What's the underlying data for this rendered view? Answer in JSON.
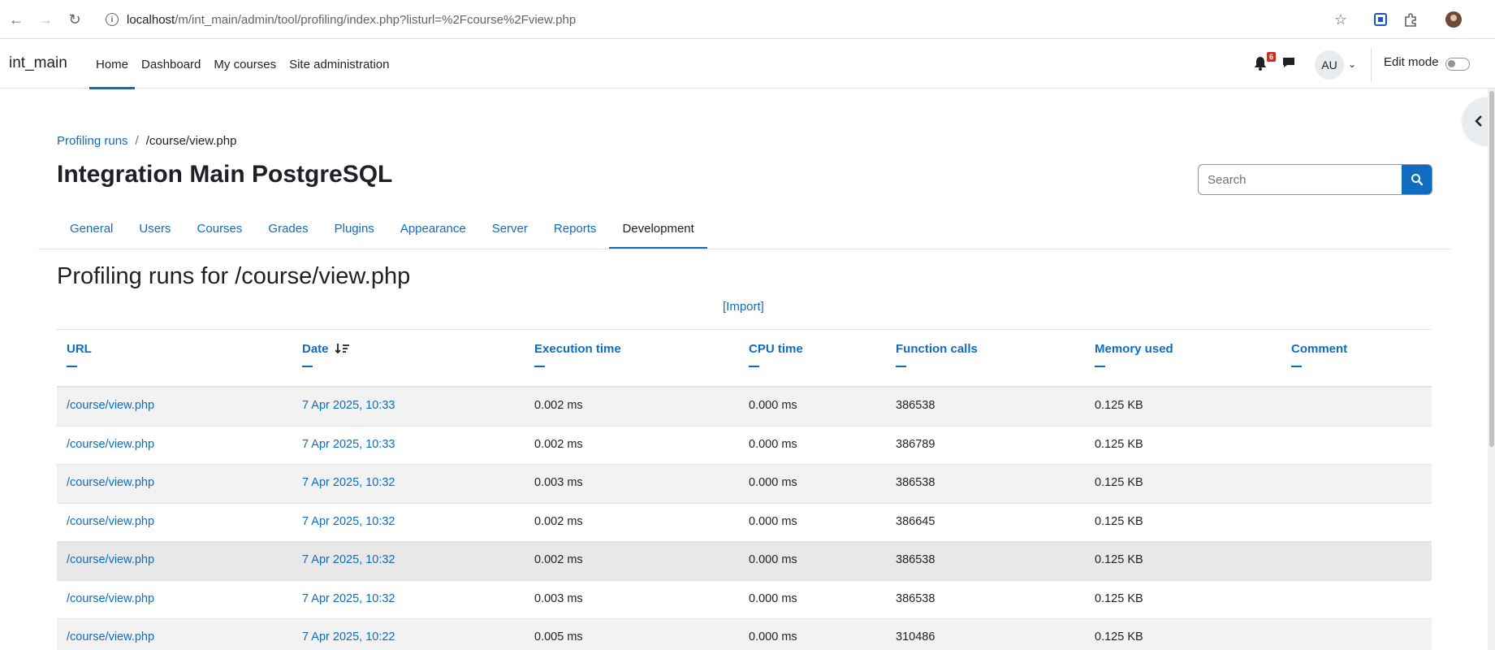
{
  "browser": {
    "url_host": "localhost",
    "url_path": "/m/int_main/admin/tool/profiling/index.php?listurl=%2Fcourse%2Fview.php"
  },
  "navbar": {
    "site_name": "int_main",
    "items": [
      {
        "label": "Home",
        "active": true
      },
      {
        "label": "Dashboard",
        "active": false
      },
      {
        "label": "My courses",
        "active": false
      },
      {
        "label": "Site administration",
        "active": false
      }
    ],
    "notification_count": "6",
    "avatar_initials": "AU",
    "edit_mode_label": "Edit mode",
    "edit_mode_on": false
  },
  "breadcrumb": {
    "link": "Profiling runs",
    "separator": "/",
    "current": "/course/view.php"
  },
  "page_title": "Integration Main PostgreSQL",
  "search": {
    "placeholder": "Search"
  },
  "tabs": [
    {
      "label": "General",
      "active": false
    },
    {
      "label": "Users",
      "active": false
    },
    {
      "label": "Courses",
      "active": false
    },
    {
      "label": "Grades",
      "active": false
    },
    {
      "label": "Plugins",
      "active": false
    },
    {
      "label": "Appearance",
      "active": false
    },
    {
      "label": "Server",
      "active": false
    },
    {
      "label": "Reports",
      "active": false
    },
    {
      "label": "Development",
      "active": true
    }
  ],
  "runs_title": "Profiling runs for /course/view.php",
  "import_label": "[Import]",
  "table": {
    "columns": [
      "URL",
      "Date",
      "Execution time",
      "CPU time",
      "Function calls",
      "Memory used",
      "Comment"
    ],
    "rows": [
      [
        "/course/view.php",
        "7 Apr 2025, 10:33",
        "0.002 ms",
        "0.000 ms",
        "386538",
        "0.125 KB",
        ""
      ],
      [
        "/course/view.php",
        "7 Apr 2025, 10:33",
        "0.002 ms",
        "0.000 ms",
        "386789",
        "0.125 KB",
        ""
      ],
      [
        "/course/view.php",
        "7 Apr 2025, 10:32",
        "0.003 ms",
        "0.000 ms",
        "386538",
        "0.125 KB",
        ""
      ],
      [
        "/course/view.php",
        "7 Apr 2025, 10:32",
        "0.002 ms",
        "0.000 ms",
        "386645",
        "0.125 KB",
        ""
      ],
      [
        "/course/view.php",
        "7 Apr 2025, 10:32",
        "0.002 ms",
        "0.000 ms",
        "386538",
        "0.125 KB",
        ""
      ],
      [
        "/course/view.php",
        "7 Apr 2025, 10:32",
        "0.003 ms",
        "0.000 ms",
        "386538",
        "0.125 KB",
        ""
      ],
      [
        "/course/view.php",
        "7 Apr 2025, 10:22",
        "0.005 ms",
        "0.000 ms",
        "310486",
        "0.125 KB",
        ""
      ]
    ]
  },
  "colors": {
    "link": "#0f6cbf",
    "text": "#1d2125",
    "badge": "#ca3120"
  }
}
